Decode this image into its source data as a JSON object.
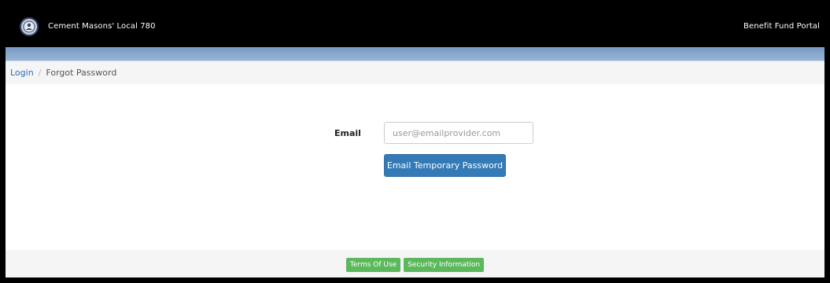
{
  "header": {
    "brand_title": "Cement Masons' Local 780",
    "portal_label": "Benefit Fund Portal",
    "logo_icon": "union-seal-icon"
  },
  "breadcrumb": {
    "login_label": "Login",
    "separator": "/",
    "current_label": "Forgot Password"
  },
  "form": {
    "email_label": "Email",
    "email_placeholder": "user@emailprovider.com",
    "email_value": "",
    "submit_label": "Email Temporary Password"
  },
  "footer": {
    "terms_label": "Terms Of Use",
    "security_label": "Security Information"
  },
  "colors": {
    "header_bg": "#000000",
    "accent_band": "#8aa8cf",
    "primary_button": "#337ab7",
    "footer_link_bg": "#5cb85c",
    "link": "#2a6dbf"
  }
}
